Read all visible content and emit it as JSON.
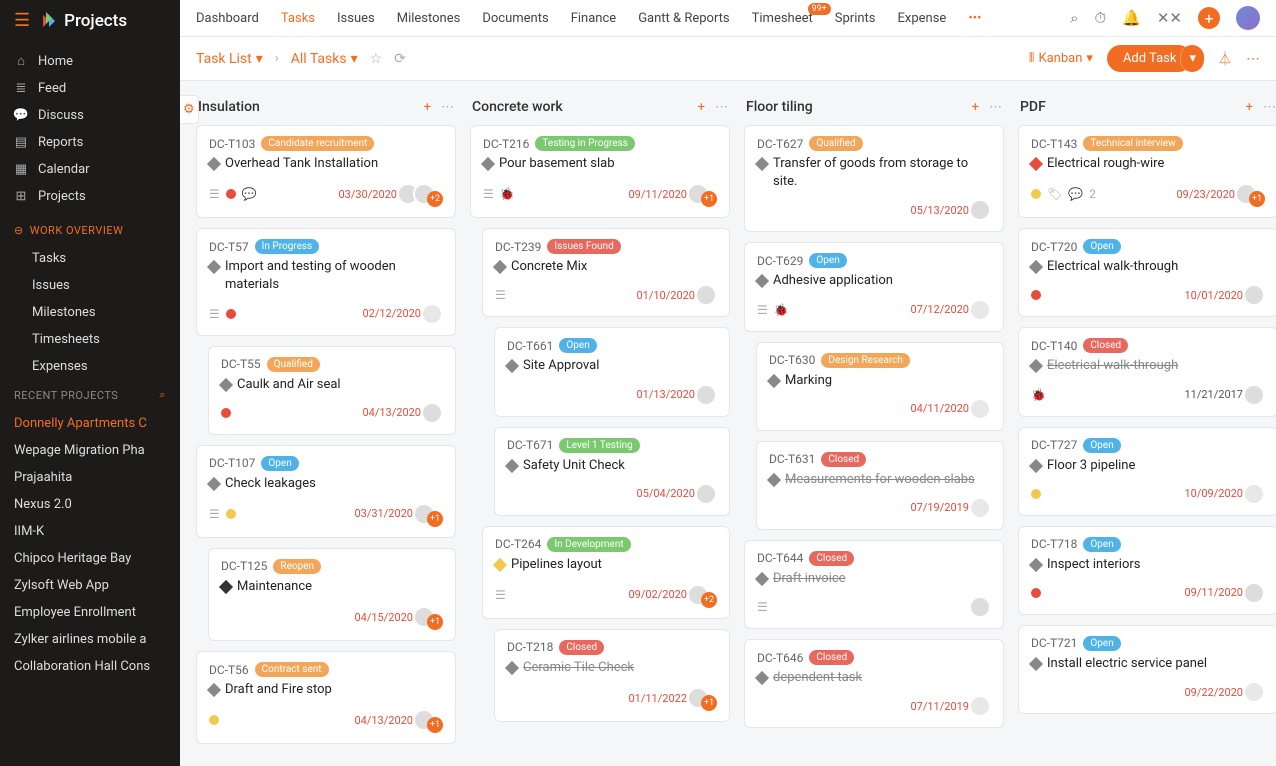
{
  "app_name": "Projects",
  "sidebar": {
    "nav": [
      {
        "icon": "home",
        "label": "Home"
      },
      {
        "icon": "feed",
        "label": "Feed"
      },
      {
        "icon": "discuss",
        "label": "Discuss"
      },
      {
        "icon": "reports",
        "label": "Reports"
      },
      {
        "icon": "calendar",
        "label": "Calendar"
      },
      {
        "icon": "projects",
        "label": "Projects"
      }
    ],
    "overview_header": "WORK OVERVIEW",
    "overview": [
      "Tasks",
      "Issues",
      "Milestones",
      "Timesheets",
      "Expenses"
    ],
    "recent_header": "RECENT PROJECTS",
    "projects": [
      "Donnelly Apartments C",
      "Wepage Migration Pha",
      "Prajaahita",
      "Nexus 2.0",
      "IIM-K",
      "Chipco Heritage Bay",
      "Zylsoft Web App",
      "Employee Enrollment",
      "Zylker airlines mobile a",
      "Collaboration Hall Cons"
    ]
  },
  "topnav": [
    "Dashboard",
    "Tasks",
    "Issues",
    "Milestones",
    "Documents",
    "Finance",
    "Gantt & Reports",
    "Timesheet",
    "Sprints",
    "Expense"
  ],
  "topnav_badge": "99+",
  "breadcrumb": {
    "root": "Task List",
    "current": "All Tasks"
  },
  "view_label": "Kanban",
  "add_task": "Add Task",
  "columns": [
    {
      "title": "Insulation",
      "cards": [
        {
          "id": "DC-T103",
          "status": "Candidate recruitment",
          "statusColor": "#f2a65a",
          "title": "Overhead Tank Installation",
          "diamond": "d-gray",
          "icons": [
            "layers",
            "flag-red",
            "comment"
          ],
          "due": "03/30/2020",
          "av": 2,
          "badge": "+2"
        },
        {
          "id": "DC-T57",
          "status": "In Progress",
          "statusColor": "#4fb3e8",
          "title": "Import and testing of wooden materials",
          "diamond": "d-gray",
          "icons": [
            "layers",
            "flag-red"
          ],
          "due": "02/12/2020",
          "av": 1,
          "empty": true
        },
        {
          "id": "DC-T55",
          "status": "Qualified",
          "statusColor": "#f2a65a",
          "title": "Caulk and Air seal",
          "diamond": "d-gray",
          "icons": [
            "flag-red"
          ],
          "due": "04/13/2020",
          "av": 1,
          "nested": 1
        },
        {
          "id": "DC-T107",
          "status": "Open",
          "statusColor": "#4fb3e8",
          "title": "Check leakages",
          "diamond": "d-gray",
          "icons": [
            "layers",
            "flag-ylw"
          ],
          "due": "03/31/2020",
          "av": 1,
          "badge": "+1"
        },
        {
          "id": "DC-T125",
          "status": "Reopen",
          "statusColor": "#f2a65a",
          "title": "Maintenance",
          "diamond": "d-dark",
          "icons": [],
          "due": "04/15/2020",
          "av": 1,
          "badge": "+1",
          "nested": 1
        },
        {
          "id": "DC-T56",
          "status": "Contract sent",
          "statusColor": "#f2a65a",
          "title": "Draft and Fire stop",
          "diamond": "d-gray",
          "icons": [
            "flag-ylw"
          ],
          "due": "04/13/2020",
          "av": 1,
          "badge": "+1"
        }
      ]
    },
    {
      "title": "Concrete work",
      "cards": [
        {
          "id": "DC-T216",
          "status": "Testing in Progress",
          "statusColor": "#7bc96f",
          "title": "Pour basement slab",
          "diamond": "d-gray",
          "icons": [
            "layers",
            "bug"
          ],
          "due": "09/11/2020",
          "av": 1,
          "badge": "+1"
        },
        {
          "id": "DC-T239",
          "status": "Issues Found",
          "statusColor": "#e7685d",
          "title": "Concrete Mix",
          "diamond": "d-gray",
          "icons": [
            "layers"
          ],
          "due": "01/10/2020",
          "av": 1,
          "nested": 1
        },
        {
          "id": "DC-T661",
          "status": "Open",
          "statusColor": "#4fb3e8",
          "title": "Site Approval",
          "diamond": "d-gray",
          "icons": [],
          "due": "01/13/2020",
          "av": 1,
          "nested": 2
        },
        {
          "id": "DC-T671",
          "status": "Level 1 Testing",
          "statusColor": "#7bc96f",
          "title": "Safety Unit Check",
          "diamond": "d-gray",
          "icons": [],
          "due": "05/04/2020",
          "av": 1,
          "nested": 2
        },
        {
          "id": "DC-T264",
          "status": "In Development",
          "statusColor": "#7bc96f",
          "title": "Pipelines layout",
          "diamond": "d-ylw",
          "icons": [
            "layers"
          ],
          "due": "09/02/2020",
          "av": 1,
          "badge": "+2",
          "nested": 1
        },
        {
          "id": "DC-T218",
          "status": "Closed",
          "statusColor": "#e7685d",
          "title": "Ceramic Tile Check",
          "diamond": "d-gray",
          "struck": true,
          "icons": [],
          "due": "01/11/2022",
          "av": 1,
          "badge": "+1",
          "nested": 2
        }
      ]
    },
    {
      "title": "Floor tiling",
      "cards": [
        {
          "id": "DC-T627",
          "status": "Qualified",
          "statusColor": "#f2a65a",
          "title": "Transfer of goods from storage to site.",
          "diamond": "d-gray",
          "icons": [],
          "due": "05/13/2020",
          "av": 1
        },
        {
          "id": "DC-T629",
          "status": "Open",
          "statusColor": "#4fb3e8",
          "title": "Adhesive application",
          "diamond": "d-gray",
          "icons": [
            "layers",
            "bug"
          ],
          "due": "07/12/2020",
          "av": 1,
          "empty": true
        },
        {
          "id": "DC-T630",
          "status": "Design Research",
          "statusColor": "#f2a65a",
          "title": "Marking",
          "diamond": "d-gray",
          "icons": [],
          "due": "04/11/2020",
          "av": 1,
          "empty": true,
          "nested": 1
        },
        {
          "id": "DC-T631",
          "status": "Closed",
          "statusColor": "#e7685d",
          "title": "Measurements for wooden slabs",
          "diamond": "d-gray",
          "struck": true,
          "icons": [],
          "due": "07/19/2019",
          "av": 1,
          "empty": true,
          "nested": 1
        },
        {
          "id": "DC-T644",
          "status": "Closed",
          "statusColor": "#e7685d",
          "title": "Draft invoice",
          "diamond": "d-gray",
          "struck": true,
          "icons": [
            "layers"
          ],
          "due": "",
          "av": 1
        },
        {
          "id": "DC-T646",
          "status": "Closed",
          "statusColor": "#e7685d",
          "title": "dependent task",
          "diamond": "d-gray",
          "struck": true,
          "icons": [],
          "due": "07/11/2019",
          "av": 1,
          "empty": true
        }
      ]
    },
    {
      "title": "PDF",
      "cards": [
        {
          "id": "DC-T143",
          "status": "Technical interview",
          "statusColor": "#f2a65a",
          "title": "Electrical rough-wire",
          "diamond": "d-red",
          "icons": [
            "flag-ylw",
            "tag",
            "comment"
          ],
          "tagCount": "2",
          "due": "09/23/2020",
          "av": 1,
          "badge": "+1"
        },
        {
          "id": "DC-T720",
          "status": "Open",
          "statusColor": "#4fb3e8",
          "title": "Electrical walk-through",
          "diamond": "d-gray",
          "icons": [
            "flag-red"
          ],
          "due": "10/01/2020",
          "av": 1
        },
        {
          "id": "DC-T140",
          "status": "Closed",
          "statusColor": "#e7685d",
          "title": "Electrical walk-through",
          "diamond": "d-gray",
          "struck": true,
          "icons": [
            "bug"
          ],
          "due": "11/21/2017",
          "duePast": true,
          "av": 1
        },
        {
          "id": "DC-T727",
          "status": "Open",
          "statusColor": "#4fb3e8",
          "title": "Floor 3 pipeline",
          "diamond": "d-gray",
          "icons": [
            "flag-ylw"
          ],
          "due": "10/09/2020",
          "av": 1,
          "empty": true
        },
        {
          "id": "DC-T718",
          "status": "Open",
          "statusColor": "#4fb3e8",
          "title": "Inspect interiors",
          "diamond": "d-gray",
          "icons": [
            "flag-red"
          ],
          "due": "09/11/2020",
          "av": 1
        },
        {
          "id": "DC-T721",
          "status": "Open",
          "statusColor": "#4fb3e8",
          "title": "Install electric service panel",
          "diamond": "d-gray",
          "icons": [],
          "due": "09/22/2020",
          "av": 1,
          "empty": true
        }
      ]
    }
  ]
}
